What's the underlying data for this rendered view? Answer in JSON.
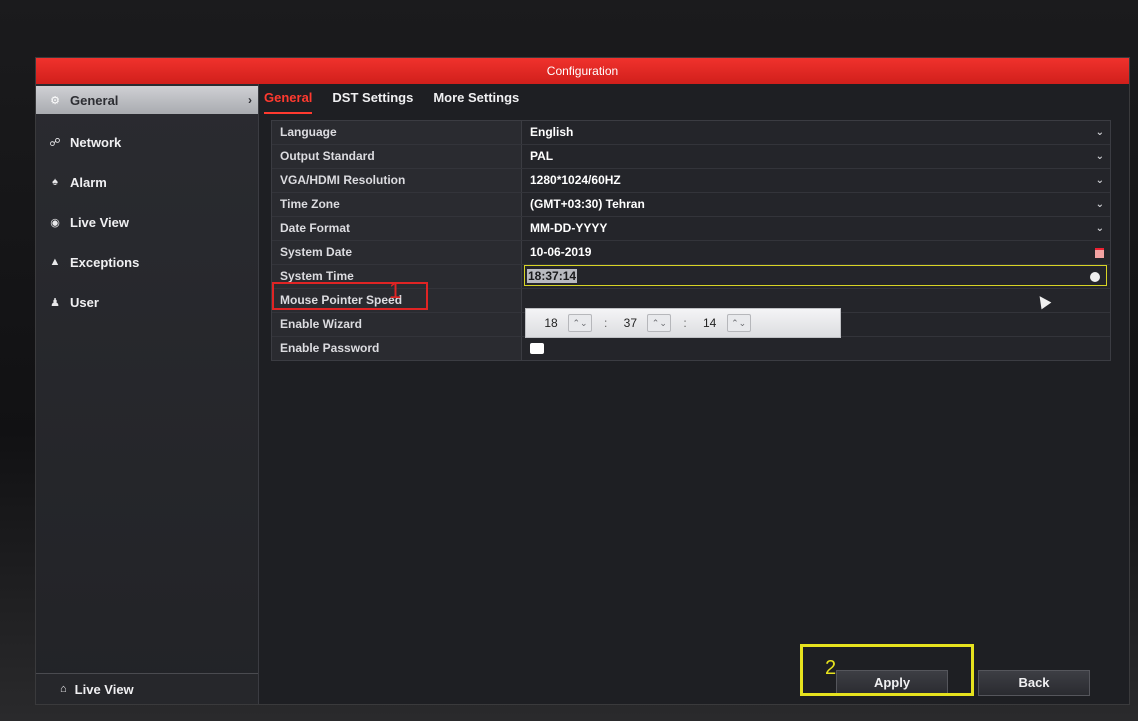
{
  "window": {
    "title": "Configuration"
  },
  "sidebar": {
    "items": [
      {
        "label": "General",
        "icon": "gear-icon",
        "glyph": "⚙",
        "active": true
      },
      {
        "label": "Network",
        "icon": "network-icon",
        "glyph": "☍"
      },
      {
        "label": "Alarm",
        "icon": "alarm-icon",
        "glyph": "♠"
      },
      {
        "label": "Live View",
        "icon": "eye-icon",
        "glyph": "◉"
      },
      {
        "label": "Exceptions",
        "icon": "warning-icon",
        "glyph": "▲"
      },
      {
        "label": "User",
        "icon": "users-icon",
        "glyph": "♟"
      }
    ],
    "footer": {
      "label": "Live View",
      "icon": "home-icon",
      "glyph": "⌂"
    }
  },
  "tabs": [
    {
      "label": "General",
      "active": true
    },
    {
      "label": "DST Settings"
    },
    {
      "label": "More Settings"
    }
  ],
  "settings": [
    {
      "label": "Language",
      "value": "English",
      "control": "dropdown"
    },
    {
      "label": "Output Standard",
      "value": "PAL",
      "control": "dropdown"
    },
    {
      "label": "VGA/HDMI Resolution",
      "value": "1280*1024/60HZ",
      "control": "dropdown"
    },
    {
      "label": "Time Zone",
      "value": "(GMT+03:30) Tehran",
      "control": "dropdown"
    },
    {
      "label": "Date Format",
      "value": "MM-DD-YYYY",
      "control": "dropdown"
    },
    {
      "label": "System Date",
      "value": "10-06-2019",
      "control": "calendar"
    },
    {
      "label": "System Time",
      "value": "18:37:14",
      "control": "time"
    },
    {
      "label": "Mouse Pointer Speed",
      "value": "",
      "control": "slider"
    },
    {
      "label": "Enable Wizard",
      "value": "",
      "control": "checkbox"
    },
    {
      "label": "Enable Password",
      "value": "",
      "control": "checkbox"
    }
  ],
  "time_spinner": {
    "hour": "18",
    "minute": "37",
    "second": "14",
    "separator": ":"
  },
  "buttons": {
    "apply": "Apply",
    "back": "Back"
  },
  "annotations": {
    "num1": "1",
    "num2": "2"
  },
  "colors": {
    "accent": "#e02424",
    "highlight": "#e6e21e",
    "title_bar": "#e0241f"
  }
}
